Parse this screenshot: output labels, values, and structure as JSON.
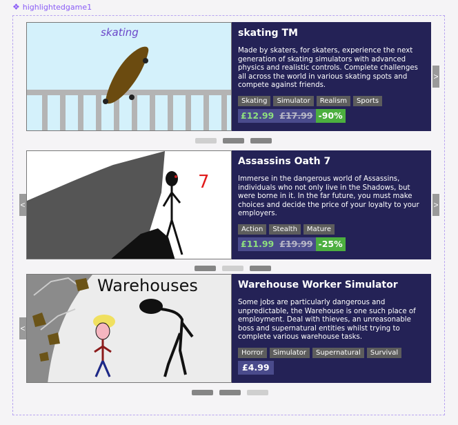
{
  "component": {
    "name": "highlightedgame1",
    "icon": "component-icon"
  },
  "slides": [
    {
      "image_caption": "skating",
      "title": "skating TM",
      "description": "Made by skaters, for skaters, experience the next generation of skating simulators with advanced physics and realistic controls. Complete challenges all across the world in various skating spots and compete against friends.",
      "tags": [
        "Skating",
        "Simulator",
        "Realism",
        "Sports"
      ],
      "price": "£12.99",
      "old_price": "£17.99",
      "discount": "-90%",
      "arrow_left": "",
      "arrow_right": ">",
      "dots": [
        "inactive",
        "active",
        "active"
      ]
    },
    {
      "image_caption": "7",
      "title": "Assassins Oath 7",
      "description": "Immerse in the dangerous world of Assassins, individuals who not only live in the Shadows, but were borne in it. In the far future, you must make choices and decide the price of your loyalty to your employers.",
      "tags": [
        "Action",
        "Stealth",
        "Mature"
      ],
      "price": "£11.99",
      "old_price": "£19.99",
      "discount": "-25%",
      "arrow_left": "<",
      "arrow_right": ">",
      "dots": [
        "active",
        "inactive",
        "active"
      ]
    },
    {
      "image_caption": "Warehouses",
      "title": "Warehouse Worker Simulator",
      "description": "Some jobs are particularly dangerous and unpredictable, the Warehouse is one such place of employment. Deal with thieves, an unreasonable boss and supernatural entities whilst trying to complete various warehouse tasks.",
      "tags": [
        "Horror",
        "Simulator",
        "Supernatural",
        "Survival"
      ],
      "price": "£4.99",
      "arrow_left": "<",
      "dots": [
        "active",
        "active",
        "inactive"
      ]
    }
  ],
  "colors": {
    "panel": "#242256",
    "price_bg": "#4a4b8c",
    "price_green": "#8ee07e",
    "discount": "#4caf3f",
    "tag_bg": "#5d5d5d",
    "frame_border": "#b7a3f0"
  }
}
